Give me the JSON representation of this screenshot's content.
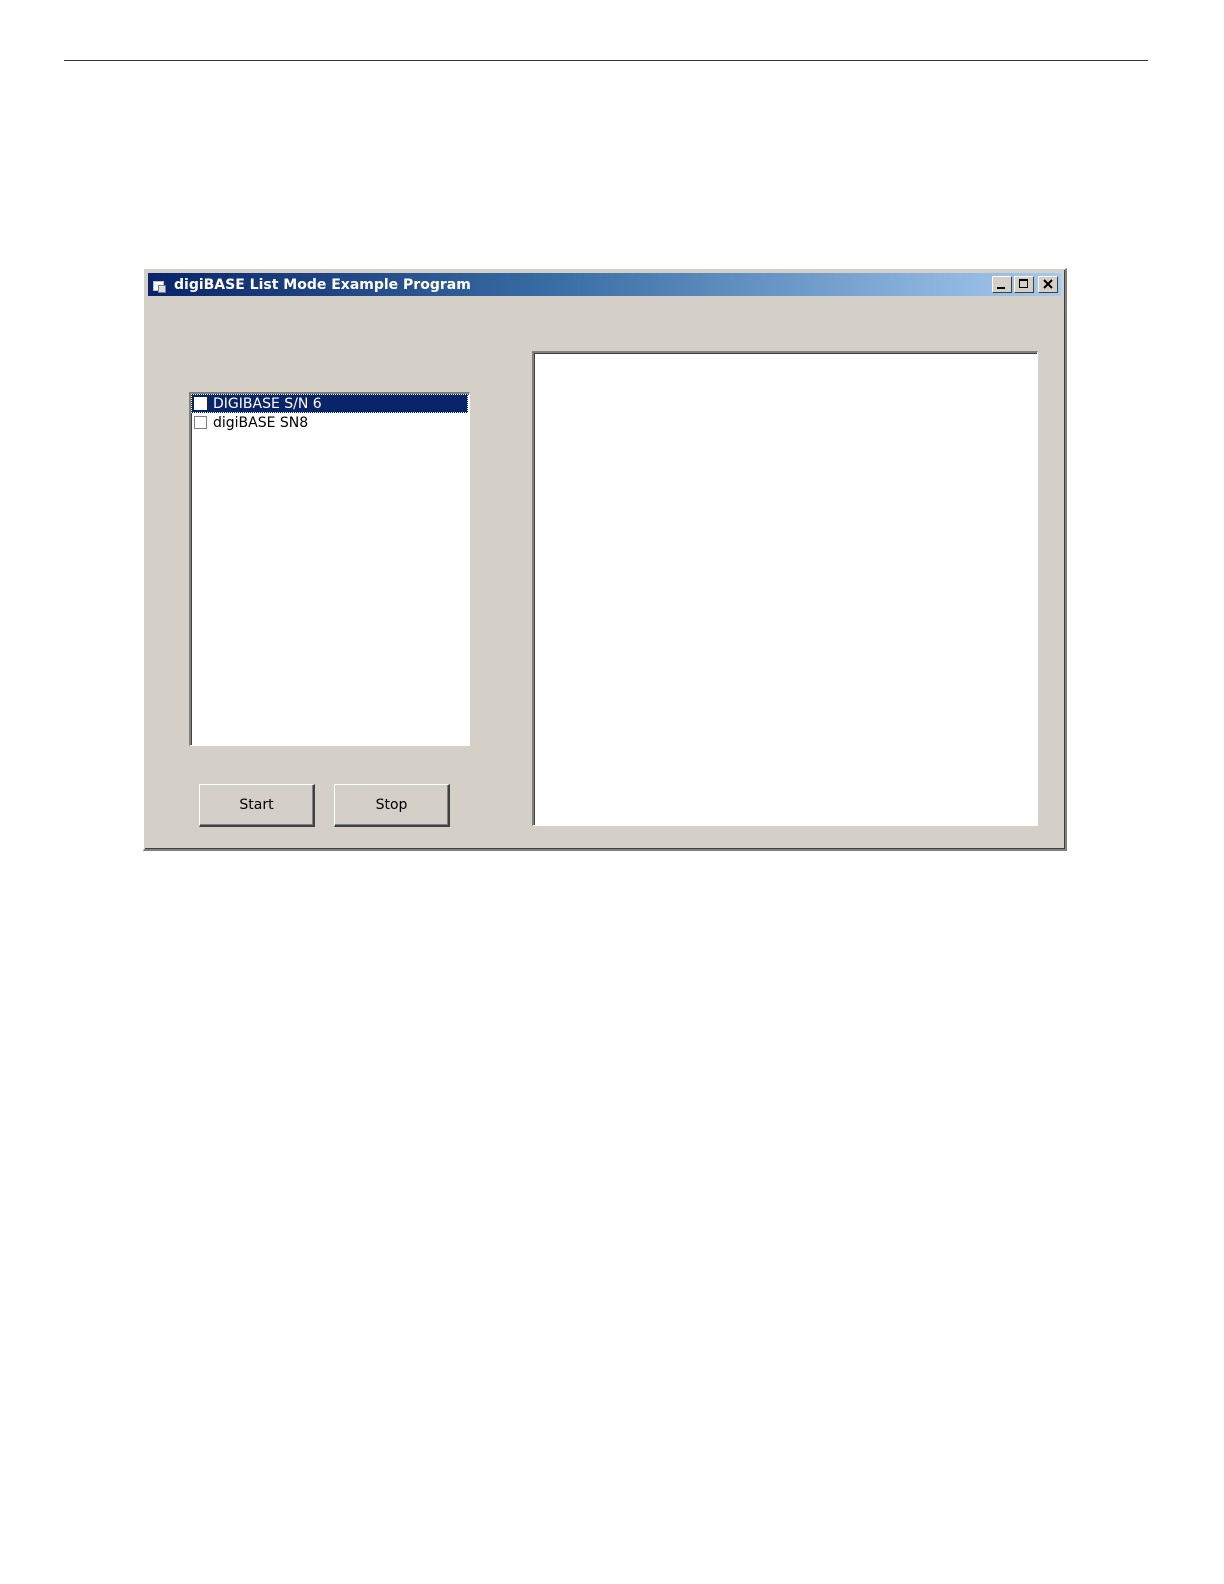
{
  "window": {
    "title": "digiBASE List Mode Example Program",
    "icon": "app-window-icon",
    "controls": {
      "minimize_icon": "minimize-icon",
      "maximize_icon": "maximize-icon",
      "close_icon": "close-icon"
    }
  },
  "device_list": {
    "items": [
      {
        "label": "DIGIBASE S/N 6",
        "checked": false,
        "selected": true
      },
      {
        "label": "digiBASE SN8",
        "checked": false,
        "selected": false
      }
    ]
  },
  "buttons": {
    "start_label": "Start",
    "stop_label": "Stop"
  },
  "output": {
    "text": ""
  },
  "colors": {
    "window_face": "#d4d0c8",
    "titlebar_start": "#0a246a",
    "titlebar_end": "#a6caf0",
    "selection": "#0a246a"
  }
}
